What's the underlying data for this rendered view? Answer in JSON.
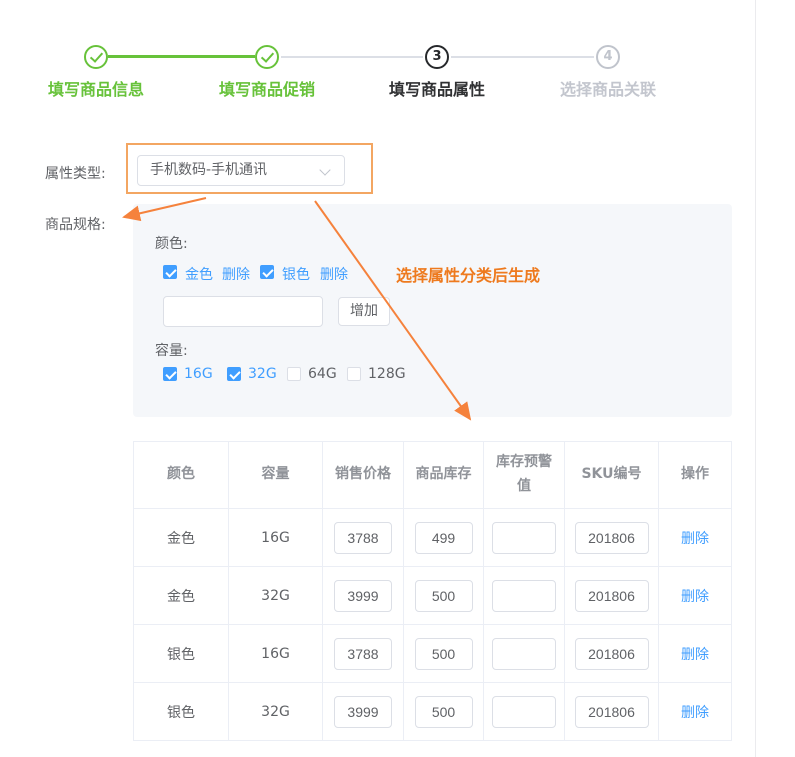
{
  "colors": {
    "accent": "#f5823c",
    "annotation_box_border": "#f3a662",
    "annotation_text": "#ee7a1e",
    "step_green": "#67c23a",
    "primary_blue": "#409eff",
    "panel_bg": "#f5f7fa"
  },
  "steps": [
    {
      "label": "填写商品信息",
      "state": "done"
    },
    {
      "label": "填写商品促销",
      "state": "done"
    },
    {
      "label": "填写商品属性",
      "state": "current",
      "number": "3"
    },
    {
      "label": "选择商品关联",
      "state": "upcoming",
      "number": "4"
    }
  ],
  "form": {
    "attr_type": {
      "label": "属性类型:",
      "value": "手机数码-手机通讯"
    },
    "spec": {
      "label": "商品规格:"
    }
  },
  "spec_panel": {
    "color": {
      "label": "颜色:",
      "options": [
        {
          "name": "金色",
          "checked": true,
          "remove_label": "删除"
        },
        {
          "name": "银色",
          "checked": true,
          "remove_label": "删除"
        }
      ],
      "new_value": "",
      "add_label": "增加"
    },
    "capacity": {
      "label": "容量:",
      "options": [
        {
          "name": "16G",
          "checked": true
        },
        {
          "name": "32G",
          "checked": true
        },
        {
          "name": "64G",
          "checked": false
        },
        {
          "name": "128G",
          "checked": false
        }
      ]
    }
  },
  "annotation": {
    "note": "选择属性分类后生成"
  },
  "sku_table": {
    "headers": [
      "颜色",
      "容量",
      "销售价格",
      "商品库存",
      "库存预警值",
      "SKU编号",
      "操作"
    ],
    "rows": [
      {
        "color": "金色",
        "capacity": "16G",
        "price": "3788",
        "stock": "499",
        "warning": "",
        "sku": "201806",
        "action": "删除"
      },
      {
        "color": "金色",
        "capacity": "32G",
        "price": "3999",
        "stock": "500",
        "warning": "",
        "sku": "201806",
        "action": "删除"
      },
      {
        "color": "银色",
        "capacity": "16G",
        "price": "3788",
        "stock": "500",
        "warning": "",
        "sku": "201806",
        "action": "删除"
      },
      {
        "color": "银色",
        "capacity": "32G",
        "price": "3999",
        "stock": "500",
        "warning": "",
        "sku": "201806",
        "action": "删除"
      }
    ]
  }
}
